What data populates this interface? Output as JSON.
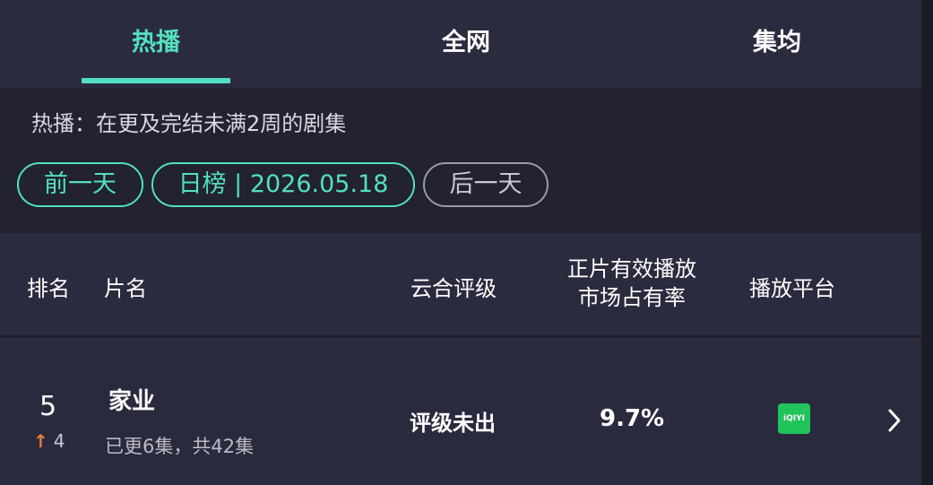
{
  "tabs": [
    {
      "label": "热播",
      "active": true
    },
    {
      "label": "全网",
      "active": false
    },
    {
      "label": "集均",
      "active": false
    }
  ],
  "description": "热播：在更及完结未满2周的剧集",
  "date_nav": {
    "prev": "前一天",
    "current": "日榜 | 2026.05.18",
    "next": "后一天"
  },
  "table_header": {
    "rank": "排名",
    "title": "片名",
    "rating": "云合评级",
    "share_line1": "正片有效播放",
    "share_line2": "市场占有率",
    "platform": "播放平台"
  },
  "rows": [
    {
      "rank": "5",
      "rank_change": "4",
      "rank_direction": "up",
      "title": "家业",
      "episodes": "已更6集，共42集",
      "rating": "评级未出",
      "market_share": "9.7%",
      "platform_logo": "iQIYI"
    }
  ],
  "colors": {
    "accent": "#52e0bf",
    "up_arrow": "#f07a3a",
    "platform_green": "#21c35b"
  }
}
